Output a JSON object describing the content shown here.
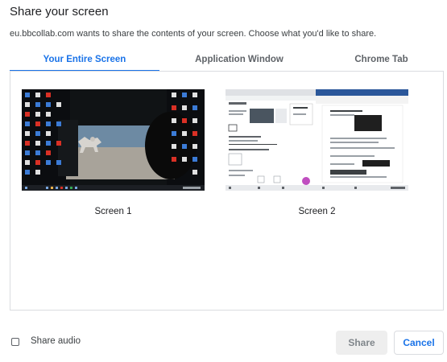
{
  "dialog": {
    "title": "Share your screen",
    "subtitle": "eu.bbcollab.com wants to share the contents of your screen. Choose what you'd like to share."
  },
  "tabs": [
    {
      "label": "Your Entire Screen",
      "active": true
    },
    {
      "label": "Application Window",
      "active": false
    },
    {
      "label": "Chrome Tab",
      "active": false
    }
  ],
  "screens": [
    {
      "label": "Screen 1"
    },
    {
      "label": "Screen 2"
    }
  ],
  "footer": {
    "share_audio_label": "Share audio",
    "share_audio_checked": false,
    "share_button": "Share",
    "cancel_button": "Cancel"
  },
  "colors": {
    "accent": "#1a73e8",
    "disabled_button_bg": "#eeeeee"
  }
}
